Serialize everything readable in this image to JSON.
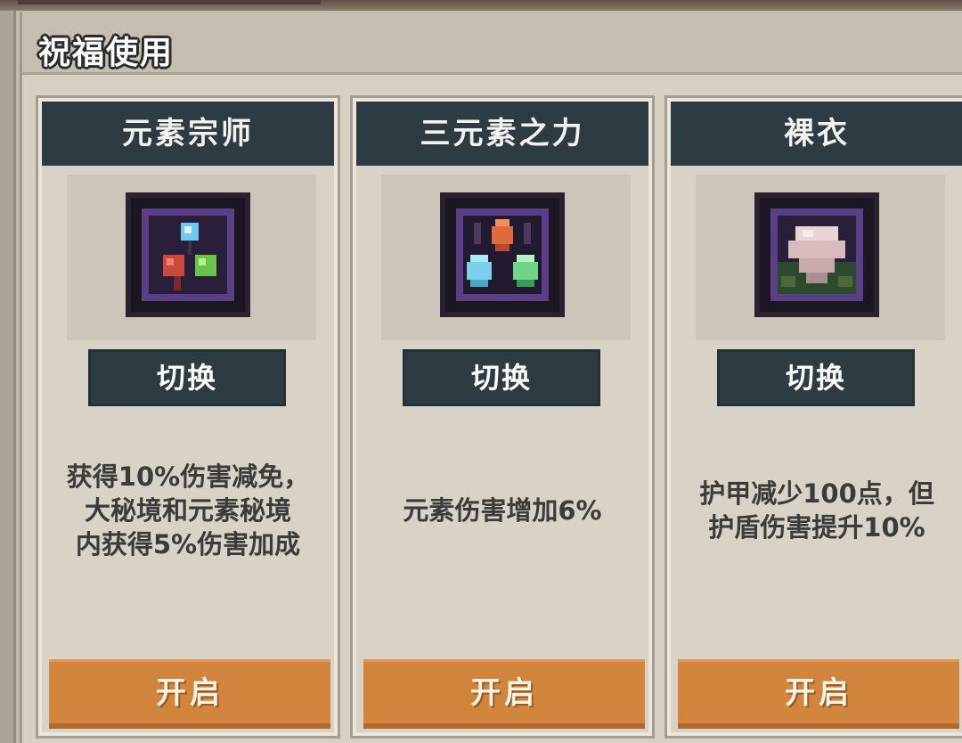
{
  "panel": {
    "title": "祝福使用"
  },
  "cards": [
    {
      "title": "元素宗师",
      "icon": "element-master-icon",
      "switch_label": "切换",
      "description": "获得10%伤害减免，\n大秘境和元素秘境\n内获得5%伤害加成",
      "open_label": "开启"
    },
    {
      "title": "三元素之力",
      "icon": "three-element-power-icon",
      "switch_label": "切换",
      "description": "元素伤害增加6%",
      "open_label": "开启"
    },
    {
      "title": "裸衣",
      "icon": "bare-clothes-icon",
      "switch_label": "切换",
      "description": "护甲减少100点，但\n护盾伤害提升10%",
      "open_label": "开启"
    }
  ],
  "colors": {
    "card_header": "#2f3b42",
    "open_button": "#d2853c",
    "panel_bg": "#d6d1c3"
  }
}
